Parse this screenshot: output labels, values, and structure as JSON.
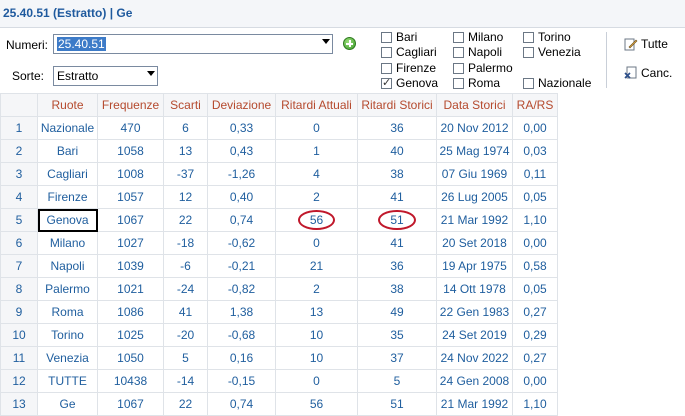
{
  "title": "25.40.51 (Estratto)  |  Ge",
  "numeri": {
    "label": "Numeri:",
    "value": "25.40.51"
  },
  "sorte": {
    "label": "Sorte:",
    "value": "Estratto"
  },
  "wheels": [
    {
      "label": "Bari",
      "checked": false
    },
    {
      "label": "Cagliari",
      "checked": false
    },
    {
      "label": "Firenze",
      "checked": false
    },
    {
      "label": "Genova",
      "checked": true
    },
    {
      "label": "Milano",
      "checked": false
    },
    {
      "label": "Napoli",
      "checked": false
    },
    {
      "label": "Palermo",
      "checked": false
    },
    {
      "label": "Roma",
      "checked": false
    },
    {
      "label": "Torino",
      "checked": false
    },
    {
      "label": "Venezia",
      "checked": false
    },
    {
      "label": "Nazionale",
      "checked": false
    }
  ],
  "buttons": {
    "tutte": "Tutte",
    "canc": "Canc."
  },
  "table": {
    "headers": [
      "Ruote",
      "Frequenze",
      "Scarti",
      "Deviazione",
      "Ritardi Attuali",
      "Ritardi Storici",
      "Data Storici",
      "RA/RS"
    ],
    "rows": [
      [
        "1",
        "Nazionale",
        "470",
        "6",
        "0,33",
        "0",
        "36",
        "20 Nov 2012",
        "0,00"
      ],
      [
        "2",
        "Bari",
        "1058",
        "13",
        "0,43",
        "1",
        "40",
        "25 Mag 1974",
        "0,03"
      ],
      [
        "3",
        "Cagliari",
        "1008",
        "-37",
        "-1,26",
        "4",
        "38",
        "07 Giu 1969",
        "0,11"
      ],
      [
        "4",
        "Firenze",
        "1057",
        "12",
        "0,40",
        "2",
        "41",
        "26 Lug 2005",
        "0,05"
      ],
      [
        "5",
        "Genova",
        "1067",
        "22",
        "0,74",
        "56",
        "51",
        "21 Mar 1992",
        "1,10"
      ],
      [
        "6",
        "Milano",
        "1027",
        "-18",
        "-0,62",
        "0",
        "41",
        "20 Set 2018",
        "0,00"
      ],
      [
        "7",
        "Napoli",
        "1039",
        "-6",
        "-0,21",
        "21",
        "36",
        "19 Apr 1975",
        "0,58"
      ],
      [
        "8",
        "Palermo",
        "1021",
        "-24",
        "-0,82",
        "2",
        "38",
        "14 Ott 1978",
        "0,05"
      ],
      [
        "9",
        "Roma",
        "1086",
        "41",
        "1,38",
        "13",
        "49",
        "22 Gen 1983",
        "0,27"
      ],
      [
        "10",
        "Torino",
        "1025",
        "-20",
        "-0,68",
        "10",
        "35",
        "24 Set 2019",
        "0,29"
      ],
      [
        "11",
        "Venezia",
        "1050",
        "5",
        "0,16",
        "10",
        "37",
        "24 Nov 2022",
        "0,27"
      ],
      [
        "12",
        "TUTTE",
        "10438",
        "-14",
        "-0,15",
        "0",
        "5",
        "24 Gen 2008",
        "0,00"
      ],
      [
        "13",
        "Ge",
        "1067",
        "22",
        "0,74",
        "56",
        "51",
        "21 Mar 1992",
        "1,10"
      ]
    ]
  },
  "colors": {
    "title": "#1f5a9e",
    "header_text": "#b54a2e",
    "cell_text": "#1f5e9e",
    "highlight_circle": "#c0182b",
    "selection": "#3d7bc8"
  }
}
